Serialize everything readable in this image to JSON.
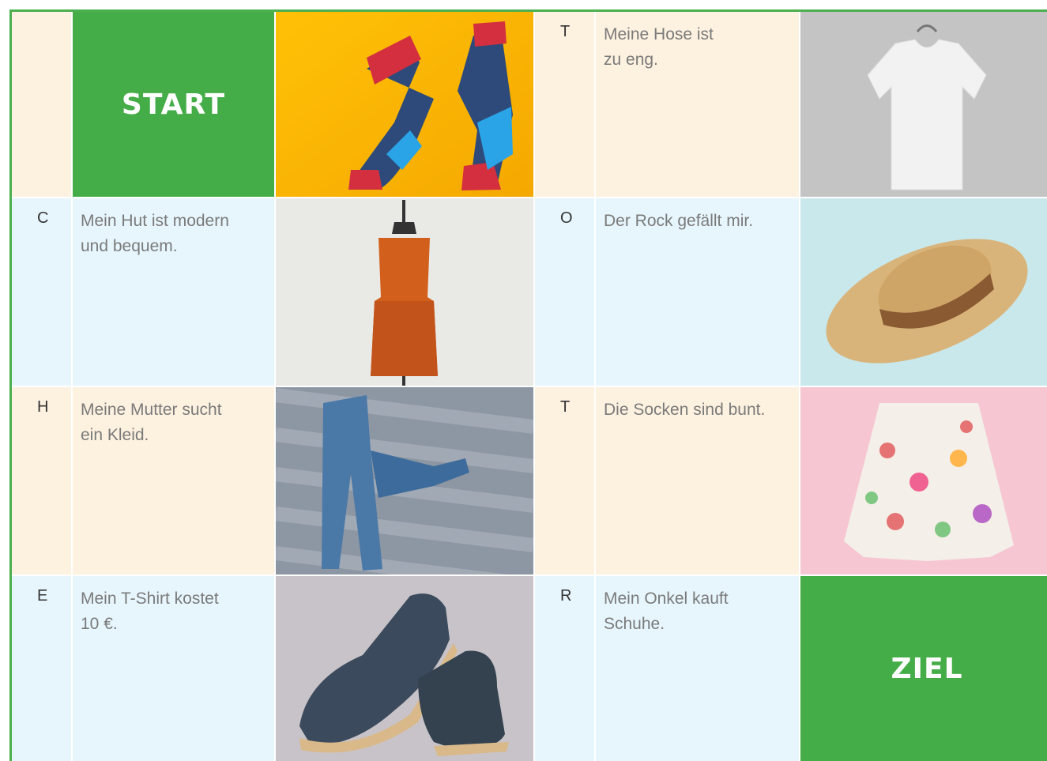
{
  "board": {
    "start": "START",
    "finish": "ZIEL",
    "rows": [
      {
        "letter_right": "T",
        "text_right": "Meine Hose ist\nzu eng.",
        "image_left": "socks-photo",
        "image_right": "tshirt-photo"
      },
      {
        "letter_left": "C",
        "text_left": "Mein Hut ist modern\nund bequem.",
        "letter_right": "O",
        "text_right": "Der Rock gefällt mir.",
        "image_left": "dress-photo",
        "image_right": "hat-photo"
      },
      {
        "letter_left": "H",
        "text_left": "Meine Mutter sucht\nein Kleid.",
        "letter_right": "T",
        "text_right": "Die Socken sind bunt.",
        "image_left": "jeans-photo",
        "image_right": "skirt-photo"
      },
      {
        "letter_left": "E",
        "text_left": "Mein T-Shirt kostet\n10 €.",
        "letter_right": "R",
        "text_right": "Mein Onkel kauft\nSchuhe.",
        "image_left": "shoes-photo"
      }
    ]
  },
  "colors": {
    "green": "#45ad48",
    "peach": "#fdf1e0",
    "light_blue": "#e7f6fd"
  }
}
